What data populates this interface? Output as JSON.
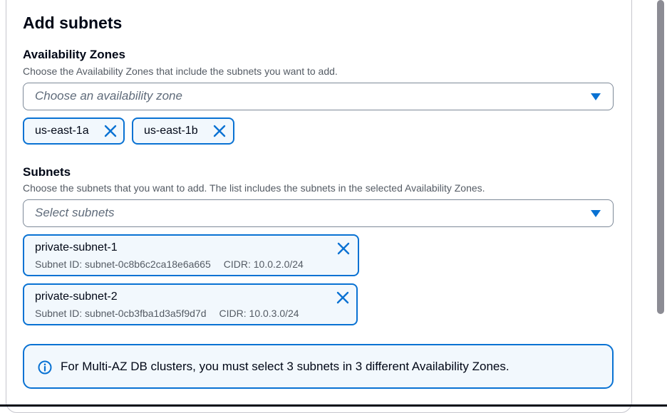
{
  "section": {
    "title": "Add subnets"
  },
  "availability_zones": {
    "label": "Availability Zones",
    "description": "Choose the Availability Zones that include the subnets you want to add.",
    "placeholder": "Choose an availability zone",
    "selected": [
      "us-east-1a",
      "us-east-1b"
    ]
  },
  "subnets": {
    "label": "Subnets",
    "description": "Choose the subnets that you want to add. The list includes the subnets in the selected Availability Zones.",
    "placeholder": "Select subnets",
    "selected": [
      {
        "name": "private-subnet-1",
        "subnet_id": "Subnet ID: subnet-0c8b6c2ca18e6a665",
        "cidr": "CIDR: 10.0.2.0/24"
      },
      {
        "name": "private-subnet-2",
        "subnet_id": "Subnet ID: subnet-0cb3fba1d3a5f9d7d",
        "cidr": "CIDR: 10.0.3.0/24"
      }
    ]
  },
  "alert": {
    "icon": "info-icon",
    "text": "For Multi-AZ DB clusters, you must select 3 subnets in 3 different Availability Zones."
  },
  "colors": {
    "accent": "#0972d3",
    "token_bg": "#f2f8fd",
    "text": "#000716",
    "secondary_text": "#545b64"
  }
}
